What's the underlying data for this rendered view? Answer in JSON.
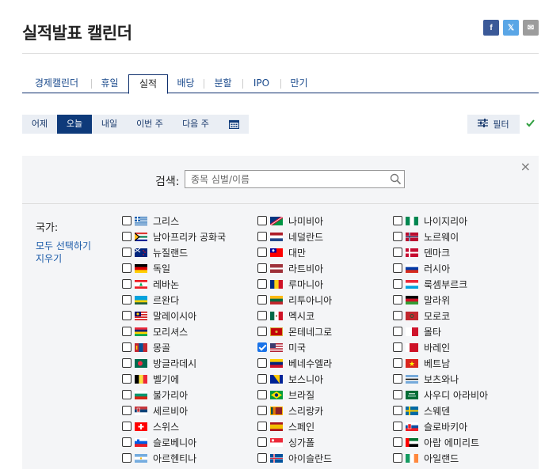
{
  "page": {
    "title": "실적발표 캘린더"
  },
  "social": [
    {
      "name": "facebook-icon",
      "glyph": "f",
      "cls": "sb-fb"
    },
    {
      "name": "x-twitter-icon",
      "glyph": "𝕏",
      "cls": "sb-x"
    },
    {
      "name": "mail-icon",
      "glyph": "✉",
      "cls": "sb-mail"
    }
  ],
  "tabs": [
    {
      "label": "경제캘린더",
      "active": false
    },
    {
      "label": "휴일",
      "active": false
    },
    {
      "label": "실적",
      "active": true
    },
    {
      "label": "배당",
      "active": false
    },
    {
      "label": "분할",
      "active": false
    },
    {
      "label": "IPO",
      "active": false
    },
    {
      "label": "만기",
      "active": false
    }
  ],
  "days": [
    {
      "label": "어제",
      "active": false
    },
    {
      "label": "오늘",
      "active": true
    },
    {
      "label": "내일",
      "active": false
    },
    {
      "label": "이번 주",
      "active": false
    },
    {
      "label": "다음 주",
      "active": false
    }
  ],
  "filter": {
    "label": "필터"
  },
  "search": {
    "label": "검색:",
    "placeholder": "종목 심벌/이름"
  },
  "countries_section": {
    "label": "국가:",
    "select_all": "모두 선택하기",
    "clear_all": "지우기"
  },
  "countries": [
    [
      {
        "name": "그리스",
        "checked": false,
        "flag": "gr"
      },
      {
        "name": "남아프리카 공화국",
        "checked": false,
        "flag": "za"
      },
      {
        "name": "뉴질랜드",
        "checked": false,
        "flag": "nz"
      },
      {
        "name": "독일",
        "checked": false,
        "flag": "de"
      },
      {
        "name": "레바논",
        "checked": false,
        "flag": "lb"
      },
      {
        "name": "르완다",
        "checked": false,
        "flag": "rw"
      },
      {
        "name": "말레이시아",
        "checked": false,
        "flag": "my"
      },
      {
        "name": "모리셔스",
        "checked": false,
        "flag": "mu"
      },
      {
        "name": "몽골",
        "checked": false,
        "flag": "mn"
      },
      {
        "name": "방글라데시",
        "checked": false,
        "flag": "bd"
      },
      {
        "name": "벨기에",
        "checked": false,
        "flag": "be"
      },
      {
        "name": "불가리아",
        "checked": false,
        "flag": "bg"
      },
      {
        "name": "세르비아",
        "checked": false,
        "flag": "rs"
      },
      {
        "name": "스위스",
        "checked": false,
        "flag": "ch"
      },
      {
        "name": "슬로베니아",
        "checked": false,
        "flag": "si"
      },
      {
        "name": "아르헨티나",
        "checked": false,
        "flag": "ar"
      }
    ],
    [
      {
        "name": "나미비아",
        "checked": false,
        "flag": "na"
      },
      {
        "name": "네덜란드",
        "checked": false,
        "flag": "nl"
      },
      {
        "name": "대만",
        "checked": false,
        "flag": "tw"
      },
      {
        "name": "라트비아",
        "checked": false,
        "flag": "lv"
      },
      {
        "name": "루마니아",
        "checked": false,
        "flag": "ro"
      },
      {
        "name": "리투아니아",
        "checked": false,
        "flag": "lt"
      },
      {
        "name": "멕시코",
        "checked": false,
        "flag": "mx"
      },
      {
        "name": "몬테네그로",
        "checked": false,
        "flag": "me"
      },
      {
        "name": "미국",
        "checked": true,
        "flag": "us"
      },
      {
        "name": "베네수엘라",
        "checked": false,
        "flag": "ve"
      },
      {
        "name": "보스니아",
        "checked": false,
        "flag": "ba"
      },
      {
        "name": "브라질",
        "checked": false,
        "flag": "br"
      },
      {
        "name": "스리랑카",
        "checked": false,
        "flag": "lk"
      },
      {
        "name": "스페인",
        "checked": false,
        "flag": "es"
      },
      {
        "name": "싱가폴",
        "checked": false,
        "flag": "sg"
      },
      {
        "name": "아이슬란드",
        "checked": false,
        "flag": "is"
      }
    ],
    [
      {
        "name": "나이지리아",
        "checked": false,
        "flag": "ng"
      },
      {
        "name": "노르웨이",
        "checked": false,
        "flag": "no"
      },
      {
        "name": "덴마크",
        "checked": false,
        "flag": "dk"
      },
      {
        "name": "러시아",
        "checked": false,
        "flag": "ru"
      },
      {
        "name": "룩셈부르크",
        "checked": false,
        "flag": "lu"
      },
      {
        "name": "말라위",
        "checked": false,
        "flag": "mw"
      },
      {
        "name": "모로코",
        "checked": false,
        "flag": "ma"
      },
      {
        "name": "몰타",
        "checked": false,
        "flag": "mt"
      },
      {
        "name": "바레인",
        "checked": false,
        "flag": "bh"
      },
      {
        "name": "베트남",
        "checked": false,
        "flag": "vn"
      },
      {
        "name": "보츠와나",
        "checked": false,
        "flag": "bw"
      },
      {
        "name": "사우디 아라비아",
        "checked": false,
        "flag": "sa"
      },
      {
        "name": "스웨덴",
        "checked": false,
        "flag": "se"
      },
      {
        "name": "슬로바키아",
        "checked": false,
        "flag": "sk"
      },
      {
        "name": "아랍 에미리트",
        "checked": false,
        "flag": "ae"
      },
      {
        "name": "아일랜드",
        "checked": false,
        "flag": "ie"
      }
    ]
  ],
  "colors": {
    "accent": "#0e3a7a",
    "link": "#1a5aa8",
    "check_green": "#2e9e3e"
  }
}
